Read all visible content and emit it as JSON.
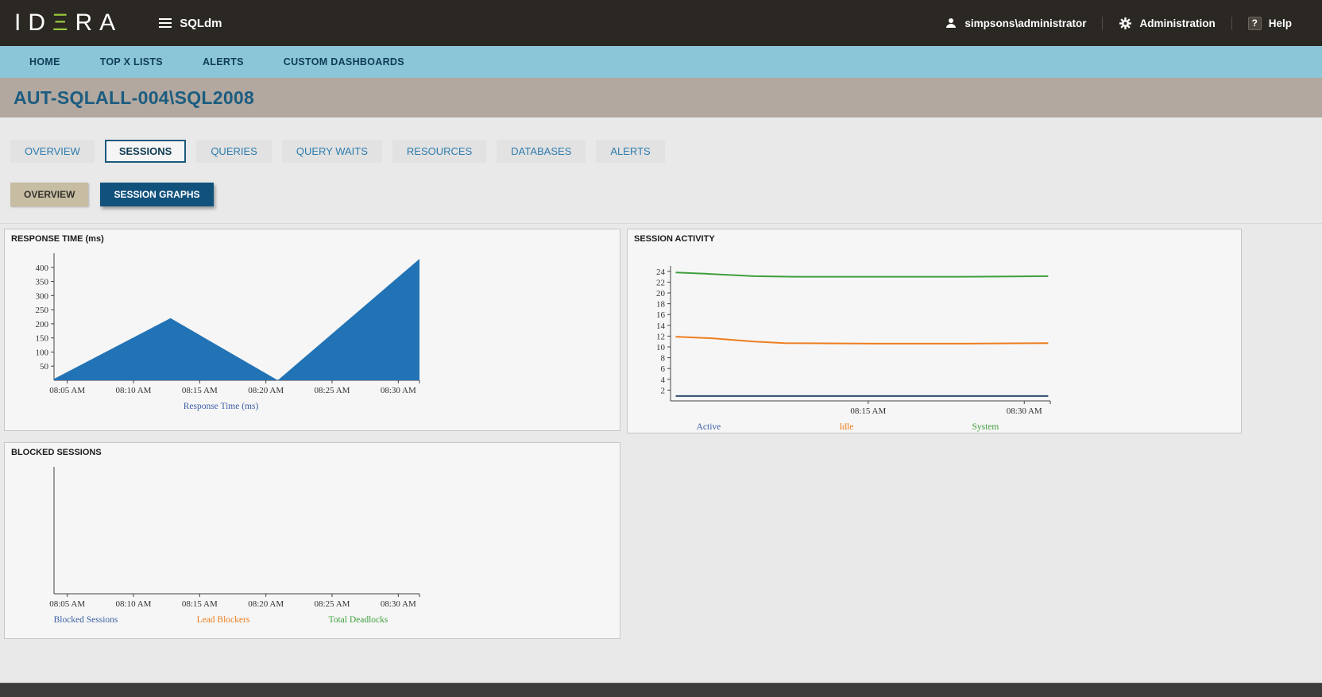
{
  "topbar": {
    "logo": {
      "part1": "ID",
      "part2": "Ξ",
      "part3": "RA"
    },
    "app_name": "SQLdm",
    "user": "simpsons\\administrator",
    "admin_label": "Administration",
    "help_label": "Help",
    "help_icon_glyph": "?"
  },
  "nav": {
    "items": [
      {
        "label": "HOME"
      },
      {
        "label": "TOP X LISTS"
      },
      {
        "label": "ALERTS"
      },
      {
        "label": "CUSTOM DASHBOARDS"
      }
    ]
  },
  "page": {
    "title": "AUT-SQLALL-004\\SQL2008"
  },
  "tabs": {
    "items": [
      "OVERVIEW",
      "SESSIONS",
      "QUERIES",
      "QUERY WAITS",
      "RESOURCES",
      "DATABASES",
      "ALERTS"
    ],
    "active": "SESSIONS"
  },
  "subtabs": {
    "items": [
      "OVERVIEW",
      "SESSION GRAPHS"
    ],
    "active": "SESSION GRAPHS"
  },
  "chart_data": [
    {
      "type": "area",
      "title": "RESPONSE TIME (ms)",
      "x": {
        "min": 4,
        "max": 31.6,
        "ticks": [
          5,
          10,
          15,
          20,
          25,
          30
        ],
        "tick_labels": [
          "08:05 AM",
          "08:10 AM",
          "08:15 AM",
          "08:20 AM",
          "08:25 AM",
          "08:30 AM"
        ]
      },
      "y": {
        "min": 0,
        "max": 450,
        "ticks": [
          50,
          100,
          150,
          200,
          250,
          300,
          350,
          400
        ]
      },
      "series": [
        {
          "name": "Response Time (ms)",
          "kind": "area",
          "color": "#2173b5",
          "points": [
            [
              4,
              5
            ],
            [
              12.8,
              220
            ],
            [
              20.9,
              0
            ],
            [
              31.6,
              430
            ]
          ]
        }
      ],
      "legend": [
        {
          "label": "Response Time (ms)",
          "color": "#3b5fa5"
        }
      ]
    },
    {
      "type": "line",
      "title": "SESSION ACTIVITY",
      "x": {
        "min": -4,
        "max": 32.5,
        "ticks": [
          15,
          30
        ],
        "tick_labels": [
          "08:15 AM",
          "08:30 AM"
        ]
      },
      "y": {
        "min": 0,
        "max": 25,
        "ticks": [
          2,
          4,
          6,
          8,
          10,
          12,
          14,
          16,
          18,
          20,
          22,
          24
        ]
      },
      "series": [
        {
          "name": "System",
          "kind": "line",
          "color": "#3f9f3c",
          "points": [
            [
              -3.5,
              23.8
            ],
            [
              0,
              23.5
            ],
            [
              4,
              23.1
            ],
            [
              8,
              23.0
            ],
            [
              16,
              23.0
            ],
            [
              24,
              23.0
            ],
            [
              32.3,
              23.1
            ]
          ]
        },
        {
          "name": "Idle",
          "kind": "line",
          "color": "#ee7d1e",
          "points": [
            [
              -3.5,
              11.9
            ],
            [
              0,
              11.6
            ],
            [
              4,
              11.0
            ],
            [
              7,
              10.7
            ],
            [
              16,
              10.6
            ],
            [
              24,
              10.6
            ],
            [
              32.3,
              10.7
            ]
          ]
        },
        {
          "name": "Active",
          "kind": "line",
          "color": "#2d4a6b",
          "points": [
            [
              -3.5,
              0.9
            ],
            [
              32.3,
              0.9
            ]
          ]
        }
      ],
      "legend": [
        {
          "label": "Active",
          "color": "#3b5fa5"
        },
        {
          "label": "Idle",
          "color": "#ee7d1e"
        },
        {
          "label": "System",
          "color": "#3f9f3c"
        }
      ]
    },
    {
      "type": "line",
      "title": "BLOCKED SESSIONS",
      "x": {
        "min": 4,
        "max": 31.6,
        "ticks": [
          5,
          10,
          15,
          20,
          25,
          30
        ],
        "tick_labels": [
          "08:05 AM",
          "08:10 AM",
          "08:15 AM",
          "08:20 AM",
          "08:25 AM",
          "08:30 AM"
        ]
      },
      "y": {
        "min": 0,
        "max": 10,
        "ticks": []
      },
      "series": [],
      "legend": [
        {
          "label": "Blocked Sessions",
          "color": "#3b5fa5"
        },
        {
          "label": "Lead Blockers",
          "color": "#ee7d1e"
        },
        {
          "label": "Total Deadlocks",
          "color": "#3f9f3c"
        }
      ]
    }
  ]
}
